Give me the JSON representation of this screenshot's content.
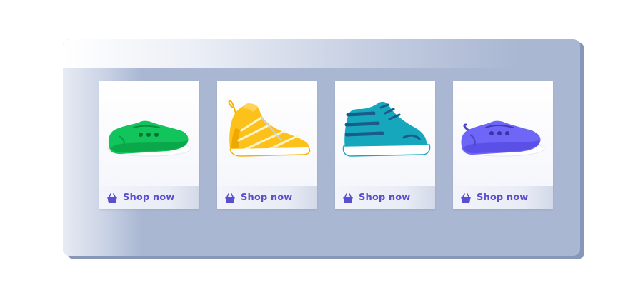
{
  "products": [
    {
      "shoe_icon": "green-sneaker-icon",
      "color": "#12c45c",
      "cta_label": "Shop now"
    },
    {
      "shoe_icon": "yellow-high-top-icon",
      "color": "#fcc21b",
      "cta_label": "Shop now"
    },
    {
      "shoe_icon": "teal-runner-icon",
      "color": "#17a7bd",
      "cta_label": "Shop now"
    },
    {
      "shoe_icon": "purple-sneaker-icon",
      "color": "#6d66f6",
      "cta_label": "Shop now"
    }
  ],
  "theme": {
    "accent": "#5a4fcf",
    "panel": "#a9b7d2"
  }
}
